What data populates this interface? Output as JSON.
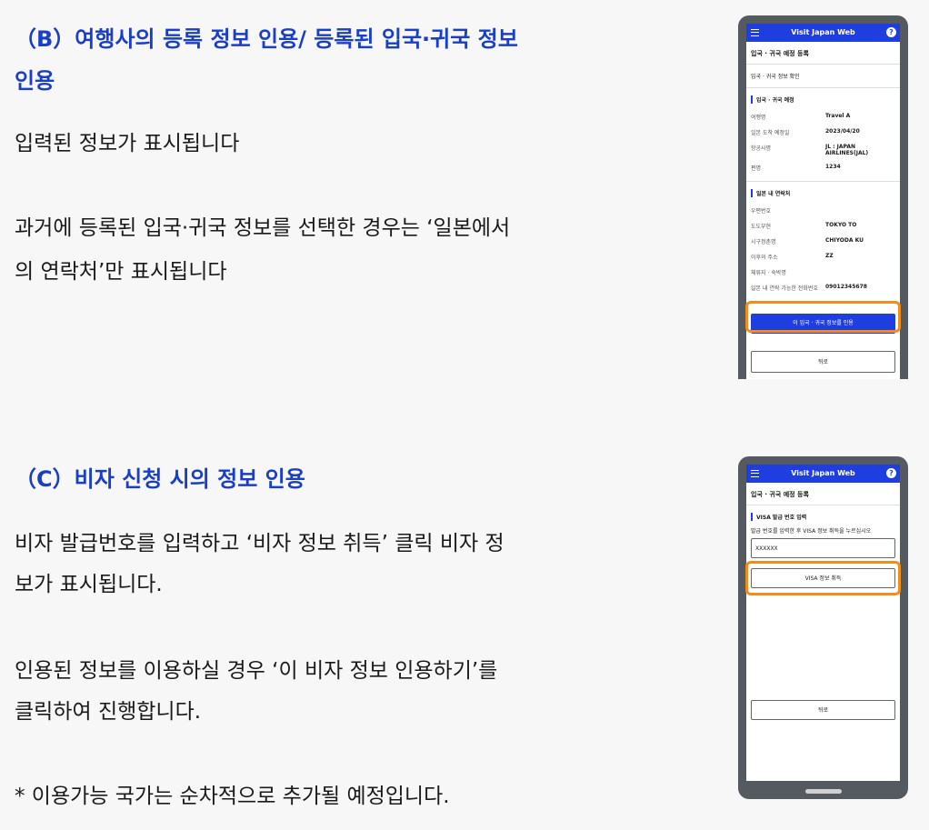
{
  "section_b": {
    "title_line1": "（B）여행사의 등록 정보 인용/ 등록된 입국·귀국 정보",
    "title_line2": "인용",
    "para1": "입력된 정보가 표시됩니다",
    "para2_line1": "과거에 등록된 입국·귀국 정보를 선택한 경우는 ‘일본에서",
    "para2_line2": "의 연락처’만 표시됩니다"
  },
  "section_c": {
    "title": "（C）비자 신청 시의 정보 인용",
    "para1_line1": "비자 발급번호를 입력하고 ‘비자 정보 취득’ 클릭 비자 정",
    "para1_line2": "보가 표시됩니다.",
    "para2_line1": "인용된 정보를 이용하실 경우 ‘이 비자 정보 인용하기’를",
    "para2_line2": "클릭하여 진행합니다.",
    "note": "* 이용가능 국가는 순차적으로 추가될 예정입니다."
  },
  "phone1": {
    "app_title": "Visit Japan Web",
    "help": "?",
    "screen_title": "입국 · 귀국 예정 등록",
    "subtitle": "입국 · 귀국 정보 확인",
    "block1_head": "입국 · 귀국 예정",
    "block1_rows": [
      {
        "k": "여행명",
        "v": "Travel A"
      },
      {
        "k": "일본 도착 예정일",
        "v": "2023/04/20"
      },
      {
        "k": "항공사명",
        "v": "JL : JAPAN AIRLINES(JAL)"
      },
      {
        "k": "편명",
        "v": "1234"
      }
    ],
    "block2_head": "일본 내 연락처",
    "block2_rows": [
      {
        "k": "우편번호",
        "v": ""
      },
      {
        "k": "도도부현",
        "v": "TOKYO TO"
      },
      {
        "k": "시구정촌명",
        "v": "CHIYODA KU"
      },
      {
        "k": "이후의 주소",
        "v": "ZZ"
      },
      {
        "k": "체류지 · 숙박명",
        "v": ""
      },
      {
        "k": "일본 내 연락 가능한 전화번호",
        "v": "09012345678"
      }
    ],
    "primary_btn": "이 입국 · 귀국 정보를 인용",
    "back_btn": "뒤로"
  },
  "phone2": {
    "app_title": "Visit Japan Web",
    "help": "?",
    "screen_title": "입국 · 귀국 예정 등록",
    "block_head": "VISA 발급 번호 입력",
    "instruction": "발급 번호를 입력한 후 VISA 정보 취득을 누르십시오",
    "input_value": "XXXXXX",
    "get_btn": "VISA 정보 취득",
    "back_btn": "뒤로"
  },
  "colors": {
    "title_blue": "#1a3fc4",
    "app_blue": "#1e3ee0",
    "highlight": "#f28c1c"
  }
}
